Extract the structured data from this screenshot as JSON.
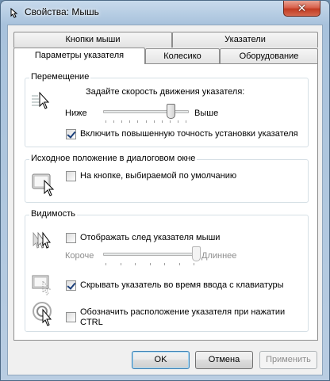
{
  "window": {
    "title": "Свойства: Мышь",
    "close_glyph": "✕"
  },
  "tabs_row_back": [
    {
      "label": "Кнопки мыши"
    },
    {
      "label": "Указатели"
    }
  ],
  "tabs_row_front": [
    {
      "label": "Параметры указателя",
      "active": true
    },
    {
      "label": "Колесико"
    },
    {
      "label": "Оборудование"
    }
  ],
  "motion": {
    "title": "Перемещение",
    "speed_label": "Задайте скорость движения указателя:",
    "slow_label": "Ниже",
    "fast_label": "Выше",
    "speed_level": 0.8,
    "precision_label": "Включить повышенную точность установки указателя",
    "precision_checked": true,
    "icon": "pointer-speed-icon"
  },
  "snap": {
    "title": "Исходное положение в диалоговом окне",
    "snap_label": "На кнопке, выбираемой по умолчанию",
    "snap_checked": false,
    "icon": "snap-to-button-icon"
  },
  "visibility": {
    "title": "Видимость",
    "trails_label": "Отображать след указателя мыши",
    "trails_checked": false,
    "short_label": "Короче",
    "long_label": "Длиннее",
    "trails_level": 1.0,
    "hide_label": "Скрывать указатель во время ввода с клавиатуры",
    "hide_checked": true,
    "ctrl_label_line1": "Обозначить расположение указателя при нажатии",
    "ctrl_label_line2": "CTRL",
    "ctrl_checked": false,
    "icons": [
      "pointer-trails-icon",
      "hide-while-typing-icon",
      "ctrl-locate-icon"
    ]
  },
  "buttons": {
    "ok": "OK",
    "cancel": "Отмена",
    "apply": "Применить"
  }
}
